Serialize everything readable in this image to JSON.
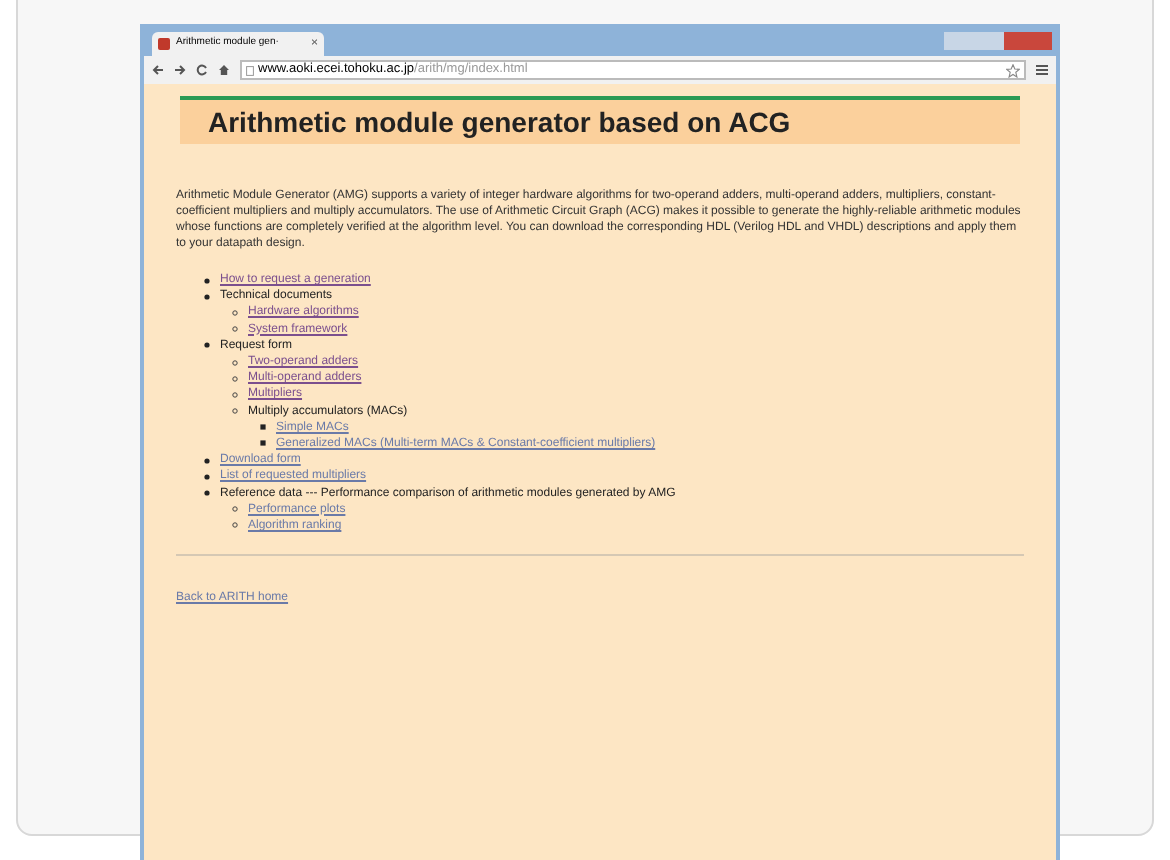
{
  "browser": {
    "tab_title": "Arithmetic module gen·",
    "tab_close": "×",
    "url_host": "www.aoki.ecei.tohoku.ac.jp",
    "url_path": "/arith/mg/index.html"
  },
  "page": {
    "heading": "Arithmetic module generator based on ACG",
    "intro": "Arithmetic Module Generator (AMG) supports a variety of integer hardware algorithms for two-operand adders, multi-operand adders, multipliers, constant-coefficient multipliers and multiply accumulators. The use of Arithmetic Circuit Graph (ACG) makes it possible to generate the highly-reliable arithmetic modules whose functions are completely verified at the algorithm level. You can download the corresponding HDL (Verilog HDL and VHDL) descriptions and apply them to your datapath design.",
    "items": [
      {
        "kind": "link",
        "text": "How to request a generation",
        "visited": true
      },
      {
        "kind": "text",
        "text": "Technical documents",
        "children": [
          {
            "kind": "link",
            "text": "Hardware algorithms",
            "visited": true
          },
          {
            "kind": "link",
            "text": "System framework",
            "visited": true
          }
        ]
      },
      {
        "kind": "text",
        "text": "Request form",
        "children": [
          {
            "kind": "link",
            "text": "Two-operand adders",
            "visited": true
          },
          {
            "kind": "link",
            "text": "Multi-operand adders",
            "visited": true
          },
          {
            "kind": "link",
            "text": "Multipliers",
            "visited": true
          },
          {
            "kind": "text",
            "text": "Multiply accumulators (MACs)",
            "children": [
              {
                "kind": "link",
                "text": "Simple MACs",
                "visited": false
              },
              {
                "kind": "link",
                "text": "Generalized MACs (Multi-term MACs & Constant-coefficient multipliers)",
                "visited": false
              }
            ]
          }
        ]
      },
      {
        "kind": "link",
        "text": "Download form",
        "visited": false
      },
      {
        "kind": "link",
        "text": "List of requested multipliers",
        "visited": false
      },
      {
        "kind": "text",
        "text": "Reference data --- Performance comparison of arithmetic modules generated by AMG",
        "children": [
          {
            "kind": "link",
            "text": "Performance plots",
            "visited": false
          },
          {
            "kind": "link",
            "text": "Algorithm ranking",
            "visited": false
          }
        ]
      }
    ],
    "back_link": {
      "text": "Back to ARITH home",
      "visited": false
    }
  }
}
